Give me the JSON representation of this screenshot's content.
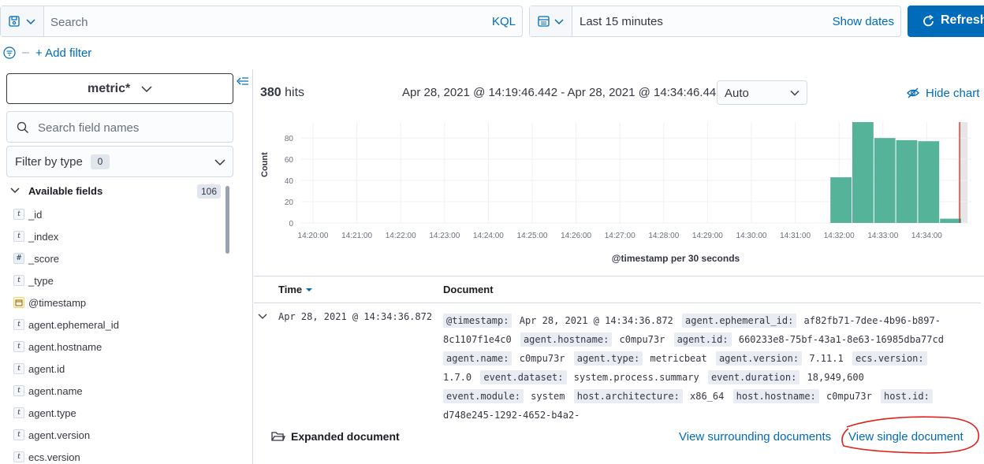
{
  "query_bar": {
    "placeholder": "Search",
    "language": "KQL"
  },
  "time_picker": {
    "range": "Last 15 minutes",
    "show_dates": "Show dates",
    "refresh": "Refresh"
  },
  "filters": {
    "add_filter": "+ Add filter"
  },
  "sidebar": {
    "index_pattern": "metric*",
    "field_search_placeholder": "Search field names",
    "filter_by_type": "Filter by type",
    "filter_by_type_count": "0",
    "available_fields_label": "Available fields",
    "available_fields_count": "106",
    "fields": [
      {
        "type": "t",
        "name": "_id"
      },
      {
        "type": "t",
        "name": "_index"
      },
      {
        "type": "#",
        "name": "_score"
      },
      {
        "type": "t",
        "name": "_type"
      },
      {
        "type": "date",
        "name": "@timestamp"
      },
      {
        "type": "t",
        "name": "agent.ephemeral_id"
      },
      {
        "type": "t",
        "name": "agent.hostname"
      },
      {
        "type": "t",
        "name": "agent.id"
      },
      {
        "type": "t",
        "name": "agent.name"
      },
      {
        "type": "t",
        "name": "agent.type"
      },
      {
        "type": "t",
        "name": "agent.version"
      },
      {
        "type": "t",
        "name": "ecs.version"
      }
    ]
  },
  "results": {
    "hits_count": "380",
    "hits_label": "hits",
    "date_range": "Apr 28, 2021 @ 14:19:46.442 - Apr 28, 2021 @ 14:34:46.442",
    "interval": "Auto",
    "hide_chart": "Hide chart"
  },
  "chart_data": {
    "type": "bar",
    "xlabel": "@timestamp per 30 seconds",
    "ylabel": "Count",
    "ylim": [
      0,
      95
    ],
    "yticks": [
      0,
      20,
      40,
      60,
      80
    ],
    "xticks": [
      "14:20:00",
      "14:21:00",
      "14:22:00",
      "14:23:00",
      "14:24:00",
      "14:25:00",
      "14:26:00",
      "14:27:00",
      "14:28:00",
      "14:29:00",
      "14:30:00",
      "14:31:00",
      "14:32:00",
      "14:33:00",
      "14:34:00"
    ],
    "bars": [
      {
        "x": "14:32:00",
        "value": 43
      },
      {
        "x": "14:32:30",
        "value": 98
      },
      {
        "x": "14:33:00",
        "value": 80
      },
      {
        "x": "14:33:30",
        "value": 78
      },
      {
        "x": "14:34:00",
        "value": 77
      },
      {
        "x": "14:34:30",
        "value": 4
      }
    ],
    "bar_color": "#54b399",
    "now_marker_color": "#bd271e"
  },
  "table": {
    "col_time": "Time",
    "col_document": "Document",
    "row_time": "Apr 28, 2021 @ 14:34:36.872",
    "fields": [
      {
        "k": "@timestamp:",
        "v": "Apr 28, 2021 @ 14:34:36.872"
      },
      {
        "k": "agent.ephemeral_id:",
        "v": "af82fb71-7dee-4b96-b897-8c1107f1e4c0"
      },
      {
        "k": "agent.hostname:",
        "v": "c0mpu73r"
      },
      {
        "k": "agent.id:",
        "v": "660233e8-75bf-43a1-8e63-16985dba77cd"
      },
      {
        "k": "agent.name:",
        "v": "c0mpu73r"
      },
      {
        "k": "agent.type:",
        "v": "metricbeat"
      },
      {
        "k": "agent.version:",
        "v": "7.11.1"
      },
      {
        "k": "ecs.version:",
        "v": "1.7.0"
      },
      {
        "k": "event.dataset:",
        "v": "system.process.summary"
      },
      {
        "k": "event.duration:",
        "v": "18,949,600"
      },
      {
        "k": "event.module:",
        "v": "system"
      },
      {
        "k": "host.architecture:",
        "v": "x86_64"
      },
      {
        "k": "host.hostname:",
        "v": "c0mpu73r"
      },
      {
        "k": "host.id:",
        "v": "d748e245-1292-4652-b4a2-"
      }
    ]
  },
  "flyout": {
    "expanded_document": "Expanded document",
    "view_surrounding": "View surrounding documents",
    "view_single": "View single document"
  }
}
